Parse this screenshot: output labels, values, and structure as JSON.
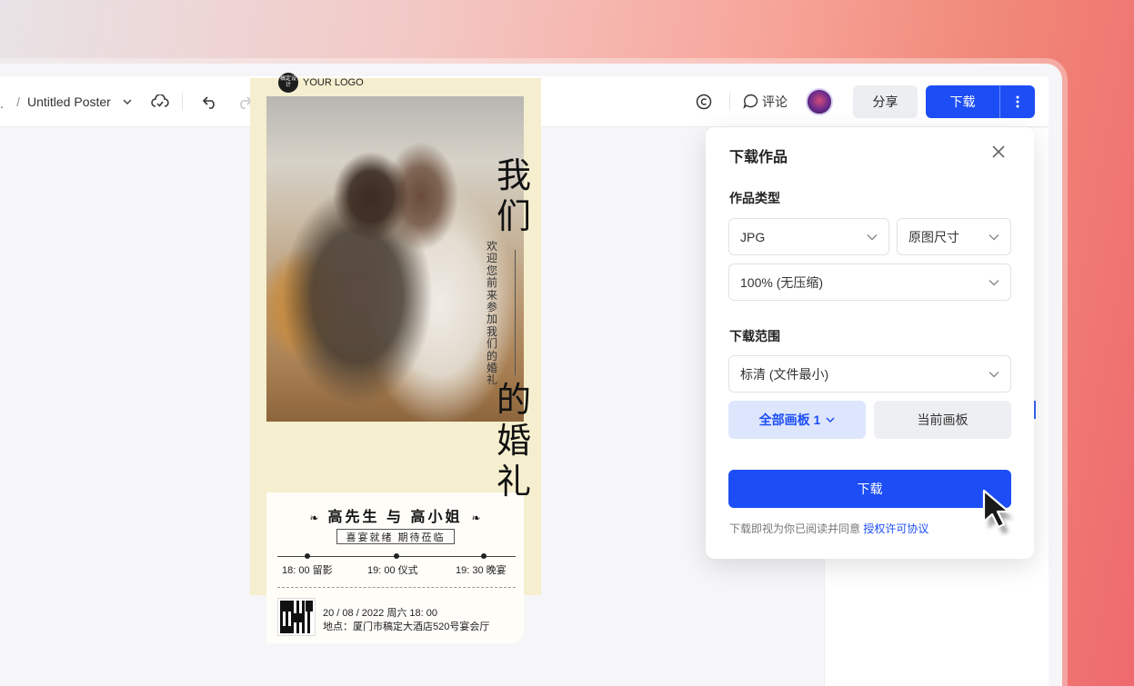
{
  "toolbar": {
    "dot": ".",
    "slash": "/",
    "title": "Untitled Poster",
    "comment_label": "评论",
    "share_label": "分享",
    "download_label": "下载"
  },
  "poster": {
    "logo_badge": "稿定设计",
    "logo_text": "YOUR LOGO",
    "title_top": [
      "我",
      "们"
    ],
    "title_bottom": [
      "的",
      "婚",
      "礼"
    ],
    "vertical_text": "欢迎您前来参加我们的婚礼",
    "names": "高先生 与 高小姐",
    "flower_left": "❧",
    "flower_right": "❧",
    "tagline": "喜宴就绪 期待莅临",
    "schedule": [
      "18: 00 留影",
      "19: 00 仪式",
      "19: 30 晚宴"
    ],
    "date": "20 / 08 / 2022 周六 18: 00",
    "address": "地点：厦门市稿定大酒店520号宴会厅"
  },
  "dialog": {
    "title": "下载作品",
    "type_label": "作品类型",
    "format": "JPG",
    "size": "原图尺寸",
    "quality": "100% (无压缩)",
    "range_label": "下载范围",
    "resolution": "标清 (文件最小)",
    "all_boards": "全部画板 1",
    "current_board": "当前画板",
    "download_button": "下载",
    "agreement_prefix": "下载即视为你已阅读并同意",
    "agreement_link": "授权许可协议"
  },
  "colors": {
    "primary": "#1d4ef5",
    "poster_bg": "#f5efcf"
  }
}
